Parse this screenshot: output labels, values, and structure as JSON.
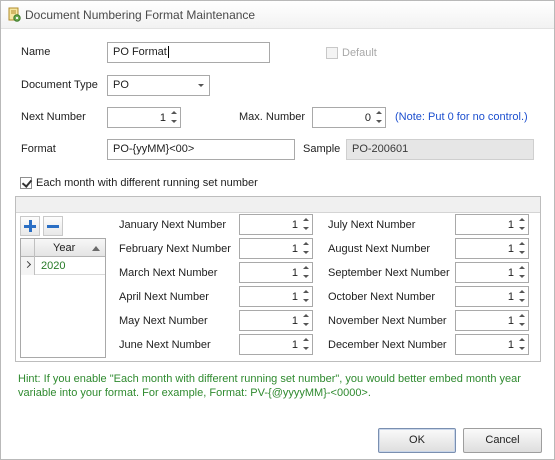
{
  "window": {
    "title": "Document Numbering Format Maintenance",
    "icon": "document-gear-icon"
  },
  "form": {
    "name_label": "Name",
    "name_value": "PO Format",
    "default_label": "Default",
    "default_checked": false,
    "doc_type_label": "Document Type",
    "doc_type_value": "PO",
    "next_number_label": "Next Number",
    "next_number_value": "1",
    "max_number_label": "Max. Number",
    "max_number_value": "0",
    "max_note": "(Note: Put 0 for no control.)",
    "format_label": "Format",
    "format_value": "PO-{yyMM}<00>",
    "sample_label": "Sample",
    "sample_value": "PO-200601",
    "monthly_label": "Each month with different running set number",
    "monthly_checked": true
  },
  "toolbar": {
    "add_icon": "plus-icon",
    "remove_icon": "minus-icon"
  },
  "year_grid": {
    "column_header": "Year",
    "sort": "ascending",
    "rows": [
      {
        "year": "2020"
      }
    ]
  },
  "months": [
    {
      "label": "January Next Number",
      "value": "1"
    },
    {
      "label": "February Next Number",
      "value": "1"
    },
    {
      "label": "March Next Number",
      "value": "1"
    },
    {
      "label": "April Next Number",
      "value": "1"
    },
    {
      "label": "May Next Number",
      "value": "1"
    },
    {
      "label": "June Next Number",
      "value": "1"
    },
    {
      "label": "July Next Number",
      "value": "1"
    },
    {
      "label": "August Next Number",
      "value": "1"
    },
    {
      "label": "September Next Number",
      "value": "1"
    },
    {
      "label": "October Next Number",
      "value": "1"
    },
    {
      "label": "November Next Number",
      "value": "1"
    },
    {
      "label": "December Next Number",
      "value": "1"
    }
  ],
  "hint": "Hint: If you enable \"Each month with different running set number\", you would better embed month year variable into your format. For example, Format: PV-{@yyyyMM}-<0000>.",
  "buttons": {
    "ok": "OK",
    "cancel": "Cancel"
  },
  "colors": {
    "hint": "#2f8a2f",
    "note": "#1c4fcf",
    "year_value": "#267a26",
    "toolbar_icon": "#2b6fc4"
  }
}
